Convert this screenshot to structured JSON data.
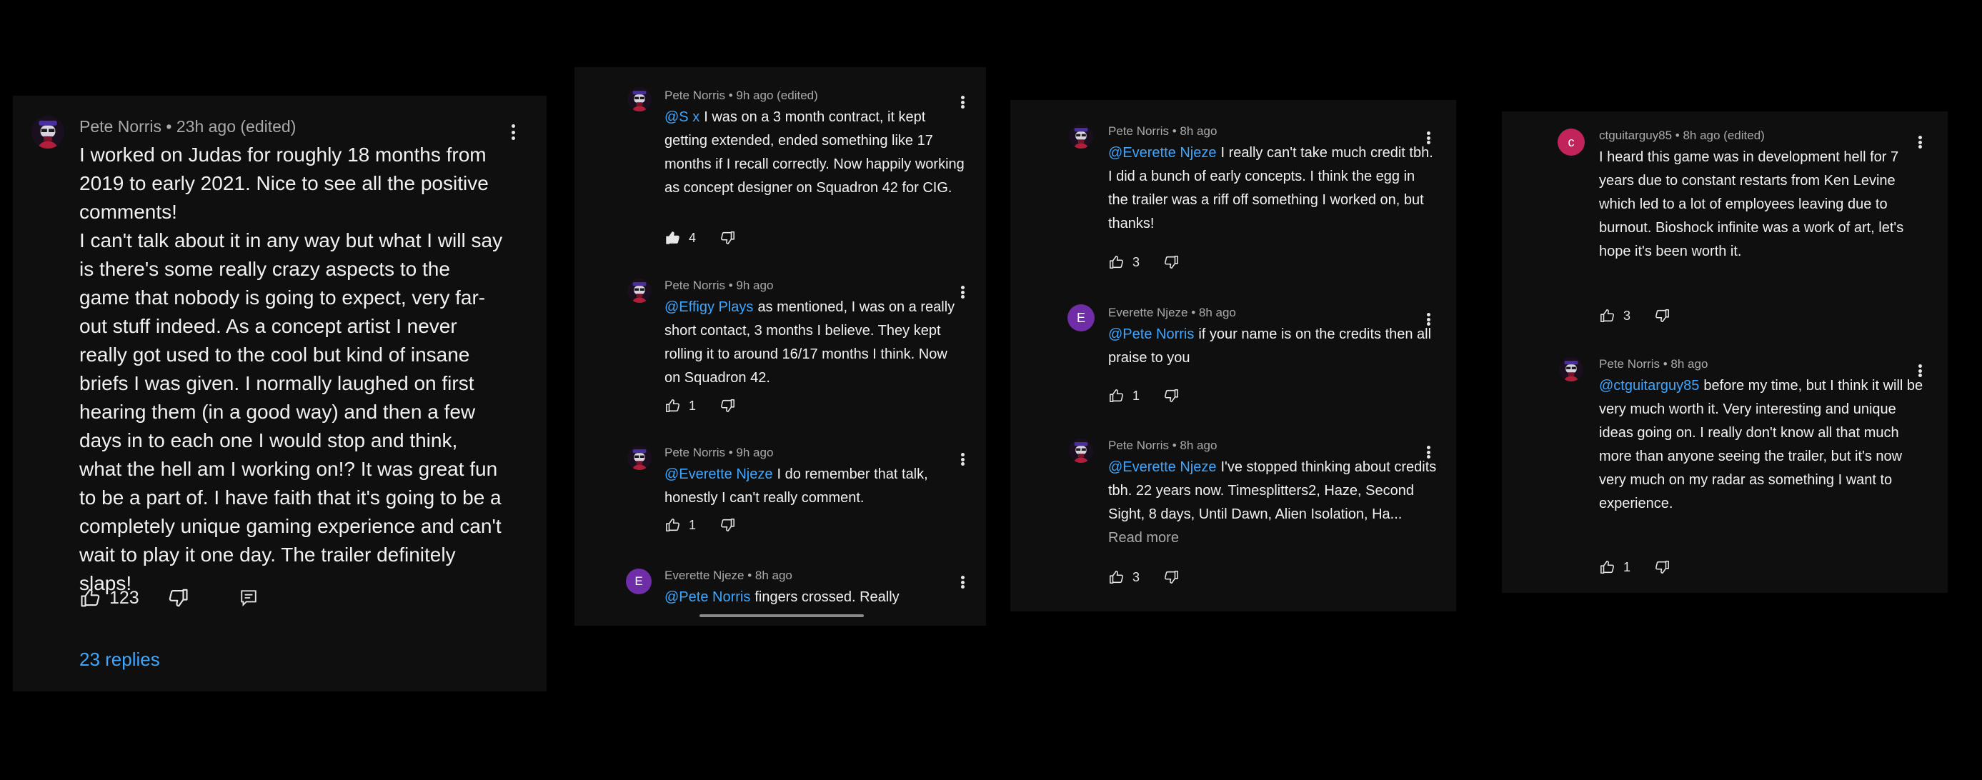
{
  "colors": {
    "background": "#000000",
    "panel": "#0f0f0f",
    "meta": "#aaaaaa",
    "mention": "#3ea6ff",
    "text": "#f1f1f1",
    "avatar_everette": "#6f2da8",
    "avatar_ctguitar": "#c0245a"
  },
  "icons": [
    "three-dot-menu-icon",
    "thumbs-up-icon",
    "thumbs-down-icon",
    "reply-icon"
  ],
  "panel1": {
    "comment": {
      "meta": "Pete Norris • 23h ago (edited)",
      "text": "I worked on Judas for roughly 18 months from 2019 to early 2021. Nice to see all the positive comments!\nI can't talk about it in any way but what I will say is there's some really crazy aspects to the game that nobody is going to expect, very far-out stuff indeed. As a concept artist I never really got used to the cool but kind of insane briefs I was given. I normally laughed on first hearing them (in a good way) and then a few days in to each one I would stop and think, what the hell am I working on!? It was great fun to be a part of. I have faith that it's going to be a completely unique gaming experience and can't wait to play it one day. The trailer definitely slaps!",
      "likes": "123"
    },
    "replies_link": "23 replies"
  },
  "panel2": {
    "comments": [
      {
        "meta": "Pete Norris • 9h ago (edited)",
        "mention": "@S x",
        "text": "I was on a 3 month contract, it kept getting extended, ended something like 17 months if I recall correctly. Now happily working as concept designer on Squadron 42 for CIG.",
        "likes": "4"
      },
      {
        "meta": "Pete Norris • 9h ago",
        "mention": "@Effigy Plays",
        "text": "as mentioned, I was on a really short contact, 3 months I believe. They kept rolling it to around 16/17 months I think. Now on Squadron 42.",
        "likes": "1"
      },
      {
        "meta": "Pete Norris • 9h ago",
        "mention": "@Everette Njeze",
        "text": "I do remember that talk, honestly I can't really comment.",
        "likes": "1"
      },
      {
        "meta": "Everette Njeze • 8h ago",
        "mention": "@Pete Norris",
        "text": "fingers crossed. Really",
        "avatar_letter": "E"
      }
    ]
  },
  "panel3": {
    "comments": [
      {
        "meta": "Pete Norris • 8h ago",
        "mention": "@Everette Njeze",
        "text": "I really can't take much credit tbh. I did a bunch of early concepts. I think the egg in the trailer was a riff off something I worked on, but thanks!",
        "likes": "3"
      },
      {
        "meta": "Everette Njeze • 8h ago",
        "mention": "@Pete Norris",
        "text": "if your name is on the credits then all praise to you",
        "likes": "1",
        "avatar_letter": "E"
      },
      {
        "meta": "Pete Norris • 8h ago",
        "mention": "@Everette Njeze",
        "text": "I've stopped thinking about credits tbh. 22 years now. Timesplitters2, Haze, Second Sight, 8 days, Until Dawn, Alien Isolation, Ha...",
        "read_more": "Read more",
        "likes": "3"
      }
    ]
  },
  "panel4": {
    "comments": [
      {
        "meta": "ctguitarguy85 • 8h ago (edited)",
        "text": "I heard this game was in development hell for 7 years due to constant restarts from Ken Levine which led to a lot of employees leaving due to burnout. Bioshock infinite was a work of art, let's hope it's been worth it.",
        "likes": "3",
        "avatar_letter": "c"
      },
      {
        "meta": "Pete Norris • 8h ago",
        "mention": "@ctguitarguy85",
        "text": "before my time, but I think it will be very much worth it. Very interesting and unique ideas going on. I really don't know all that much more than anyone seeing the trailer, but it's now very much on my radar as something I want to experience.",
        "likes": "1"
      }
    ]
  }
}
